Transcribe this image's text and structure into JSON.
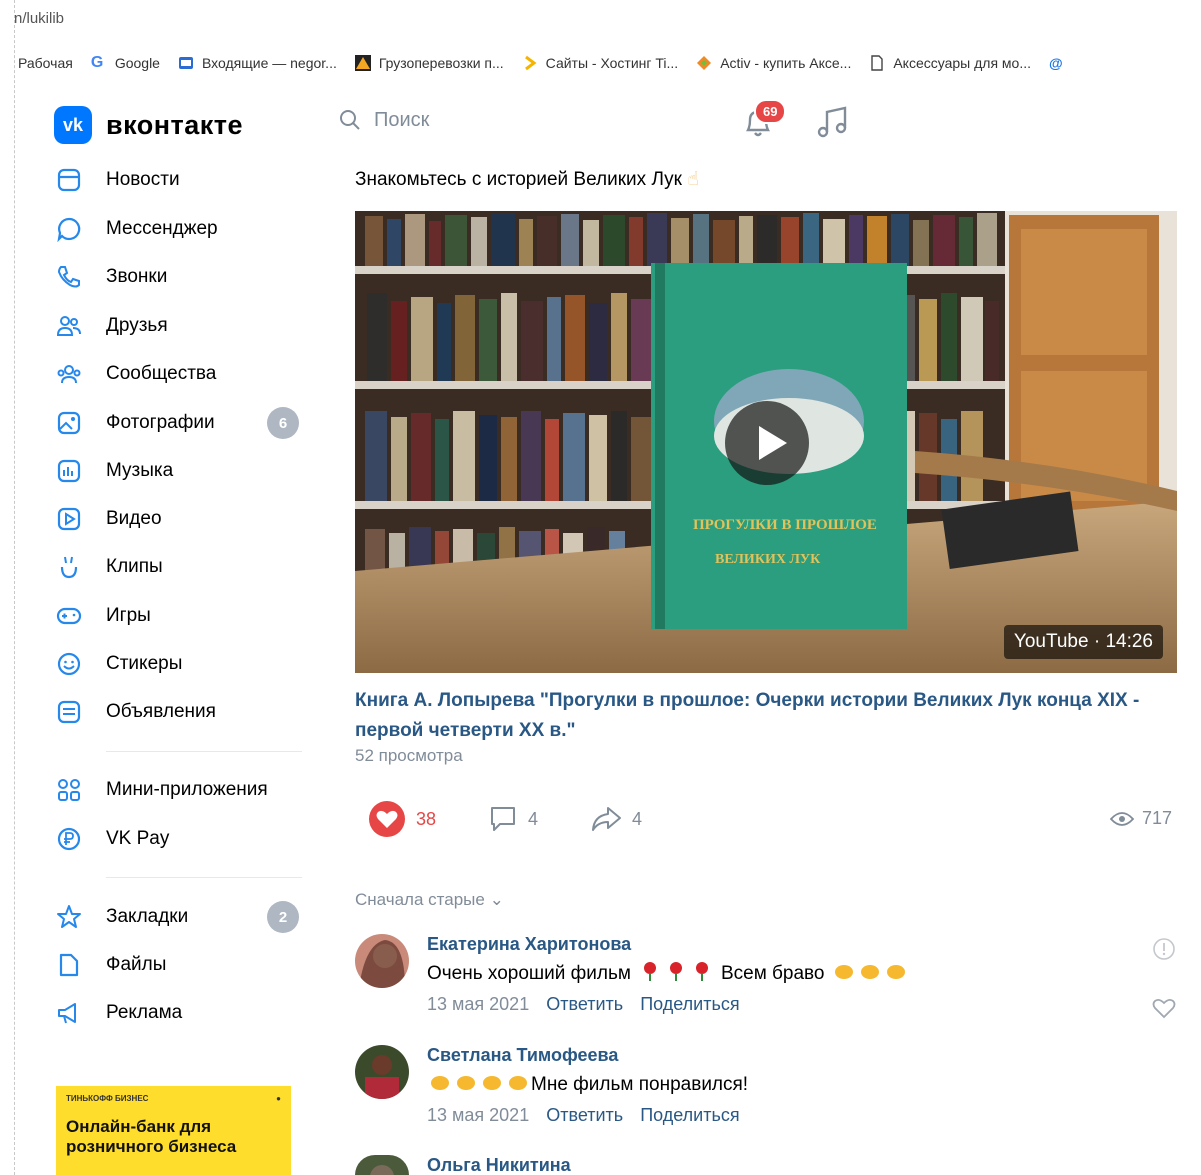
{
  "browser": {
    "url": "n/lukilib",
    "bookmarks": [
      {
        "label": "Рабочая",
        "icon": "none"
      },
      {
        "label": "Google",
        "icon": "google-icon"
      },
      {
        "label": "Входящие — negor...",
        "icon": "mail-icon"
      },
      {
        "label": "Грузоперевозки п...",
        "icon": "triangle-logo-icon"
      },
      {
        "label": "Сайты - Хостинг Ti...",
        "icon": "chevron-logo-icon"
      },
      {
        "label": "Activ - купить Аксе...",
        "icon": "diamond-logo-icon"
      },
      {
        "label": "Аксессуары для мо...",
        "icon": "page-icon"
      }
    ]
  },
  "header": {
    "logo_text": "вконтакте",
    "logo_mark": "vk",
    "search_placeholder": "Поиск",
    "notifications_count": "69"
  },
  "sidebar": {
    "items": [
      {
        "label": "Новости",
        "icon": "news-icon"
      },
      {
        "label": "Мессенджер",
        "icon": "messenger-icon"
      },
      {
        "label": "Звонки",
        "icon": "phone-icon"
      },
      {
        "label": "Друзья",
        "icon": "friends-icon"
      },
      {
        "label": "Сообщества",
        "icon": "communities-icon"
      },
      {
        "label": "Фотографии",
        "icon": "photo-icon",
        "badge": "6"
      },
      {
        "label": "Музыка",
        "icon": "music-icon"
      },
      {
        "label": "Видео",
        "icon": "video-icon"
      },
      {
        "label": "Клипы",
        "icon": "clips-icon"
      },
      {
        "label": "Игры",
        "icon": "gamepad-icon"
      },
      {
        "label": "Стикеры",
        "icon": "smile-icon"
      },
      {
        "label": "Объявления",
        "icon": "classifieds-icon"
      },
      {
        "label": "Мини-приложения",
        "icon": "apps-icon"
      },
      {
        "label": "VK Pay",
        "icon": "vkpay-icon"
      },
      {
        "label": "Закладки",
        "icon": "star-icon",
        "badge": "2"
      },
      {
        "label": "Файлы",
        "icon": "file-icon"
      },
      {
        "label": "Реклама",
        "icon": "megaphone-icon"
      }
    ],
    "ad": {
      "brand": "ТИНЬКОФФ БИЗНЕС",
      "title": "Онлайн-банк для розничного бизнеса"
    }
  },
  "post": {
    "text": "Знакомьтесь с историей Великих Лук",
    "video": {
      "source_badge": "YouTube · 14:26",
      "title": "Книга А. Лопырева \"Прогулки в прошлое: Очерки истории Великих Лук конца XIX - первой четверти XX в.\"",
      "views": "52 просмотра",
      "book_title": "ПРОГУЛКИ В ПРОШЛОЕ",
      "book_subtitle": "ВЕЛИКИХ ЛУК"
    },
    "likes": "38",
    "comments": "4",
    "shares": "4",
    "views": "717"
  },
  "comments_section": {
    "sort_label": "Сначала старые",
    "reply_label": "Ответить",
    "share_label": "Поделиться",
    "items": [
      {
        "author": "Екатерина Харитонова",
        "text_before": "Очень хороший фильм",
        "text_after": "Всем браво",
        "date": "13 мая 2021"
      },
      {
        "author": "Светлана Тимофеева",
        "text_before": "",
        "text_after": "Мне фильм понравился!",
        "date": "13 мая 2021"
      },
      {
        "author": "Ольга Никитина",
        "text_before": "",
        "text_after": "",
        "date": ""
      }
    ]
  },
  "colors": {
    "vk_blue": "#0077ff",
    "link": "#2a5885",
    "muted": "#818c99",
    "like_red": "#e64646",
    "ad_yellow": "#ffdd2d"
  }
}
